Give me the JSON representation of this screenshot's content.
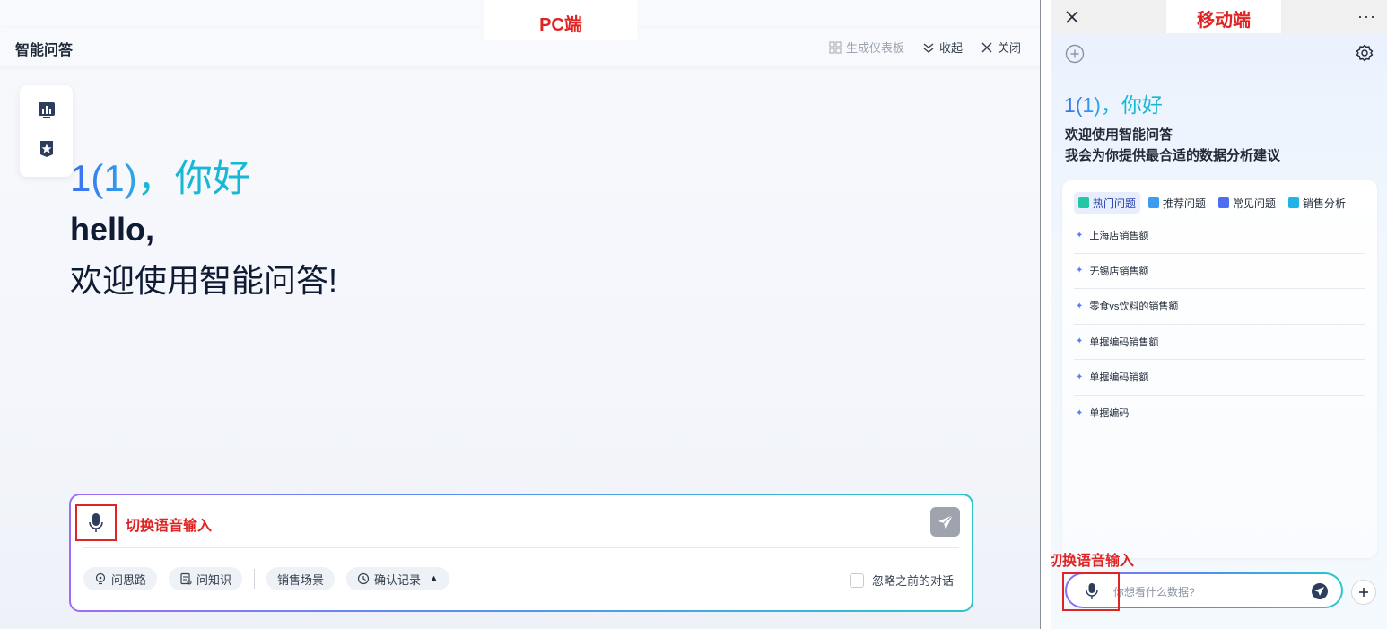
{
  "annotations": {
    "pc_label": "PC端",
    "mobile_label": "移动端",
    "pc_voice_label": "切换语音输入",
    "mobile_voice_label": "切换语音输入"
  },
  "pc": {
    "title": "智能问答",
    "actions": [
      {
        "label": "生成仪表板",
        "icon": "dashboard-icon",
        "disabled": true
      },
      {
        "label": "收起",
        "icon": "collapse-icon"
      },
      {
        "label": "关闭",
        "icon": "close-icon"
      }
    ],
    "rail": [
      {
        "icon": "chart-icon"
      },
      {
        "icon": "star-badge-icon"
      }
    ],
    "greeting_name": "1(1)",
    "greeting_suffix": "，你好",
    "hello": "hello,",
    "welcome": "欢迎使用智能问答!",
    "chips": [
      {
        "label": "问思路",
        "icon": "lightbulb-icon"
      },
      {
        "label": "问知识",
        "icon": "document-icon"
      },
      {
        "label": "销售场景",
        "icon": ""
      },
      {
        "label": "确认记录",
        "icon": "clock-icon",
        "trailing": "▲"
      }
    ],
    "ignore_label": "忽略之前的对话"
  },
  "mobile": {
    "more": "···",
    "greeting_name": "1(1)",
    "greeting_suffix": "，你好",
    "welcome_line1": "欢迎使用智能问答",
    "welcome_line2": "我会为你提供最合适的数据分析建议",
    "tabs": [
      {
        "label": "热门问题",
        "color": "#22c7a5",
        "active": true
      },
      {
        "label": "推荐问题",
        "color": "#3b9cf0",
        "active": false
      },
      {
        "label": "常见问题",
        "color": "#4f6df0",
        "active": false
      },
      {
        "label": "销售分析",
        "color": "#21b3e6",
        "active": false
      }
    ],
    "questions": [
      "上海店销售额",
      "无锡店销售额",
      "零食vs饮料的销售额",
      "单据编码销售额",
      "单据编码销额",
      "单据编码"
    ],
    "input_placeholder": "你想看什么数据?"
  }
}
